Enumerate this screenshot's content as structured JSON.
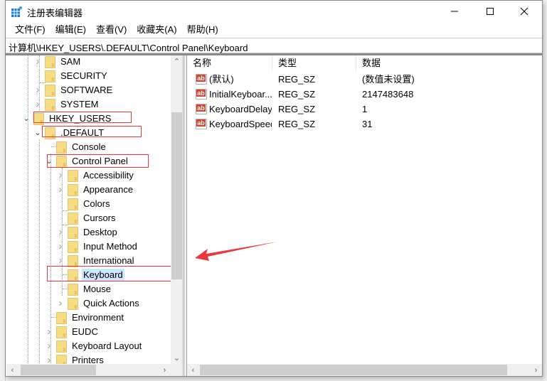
{
  "window": {
    "title": "注册表编辑器",
    "controls": {
      "minimize": "minimize",
      "maximize": "maximize",
      "close": "close"
    }
  },
  "menu": [
    {
      "label": "文件(F)"
    },
    {
      "label": "编辑(E)"
    },
    {
      "label": "查看(V)"
    },
    {
      "label": "收藏夹(A)"
    },
    {
      "label": "帮助(H)"
    }
  ],
  "address": {
    "path": "计算机\\HKEY_USERS\\.DEFAULT\\Control Panel\\Keyboard"
  },
  "tree": {
    "items": [
      {
        "label": "SAM",
        "expander": "collapsed",
        "level": 2
      },
      {
        "label": "SECURITY",
        "expander": "none",
        "level": 2
      },
      {
        "label": "SOFTWARE",
        "expander": "collapsed",
        "level": 2
      },
      {
        "label": "SYSTEM",
        "expander": "collapsed",
        "level": 2
      },
      {
        "label": "HKEY_USERS",
        "expander": "expanded",
        "level": 1,
        "highlighted": true
      },
      {
        "label": ".DEFAULT",
        "expander": "expanded",
        "level": 2,
        "highlighted": true
      },
      {
        "label": "Console",
        "expander": "none",
        "level": 3
      },
      {
        "label": "Control Panel",
        "expander": "expanded",
        "level": 3,
        "highlighted": true
      },
      {
        "label": "Accessibility",
        "expander": "collapsed",
        "level": 4
      },
      {
        "label": "Appearance",
        "expander": "collapsed",
        "level": 4
      },
      {
        "label": "Colors",
        "expander": "none",
        "level": 4
      },
      {
        "label": "Cursors",
        "expander": "none",
        "level": 4
      },
      {
        "label": "Desktop",
        "expander": "collapsed",
        "level": 4
      },
      {
        "label": "Input Method",
        "expander": "collapsed",
        "level": 4
      },
      {
        "label": "International",
        "expander": "collapsed",
        "level": 4
      },
      {
        "label": "Keyboard",
        "expander": "none",
        "level": 4,
        "selected": true,
        "highlighted": true
      },
      {
        "label": "Mouse",
        "expander": "none",
        "level": 4
      },
      {
        "label": "Quick Actions",
        "expander": "collapsed",
        "level": 4
      },
      {
        "label": "Environment",
        "expander": "none",
        "level": 3
      },
      {
        "label": "EUDC",
        "expander": "collapsed",
        "level": 3
      },
      {
        "label": "Keyboard Layout",
        "expander": "collapsed",
        "level": 3
      },
      {
        "label": "Printers",
        "expander": "collapsed",
        "level": 3
      }
    ]
  },
  "list": {
    "columns": [
      {
        "label": "名称"
      },
      {
        "label": "类型"
      },
      {
        "label": "数据"
      }
    ],
    "rows": [
      {
        "name": "(默认)",
        "type": "REG_SZ",
        "data": "(数值未设置)",
        "icon": "string-value-icon"
      },
      {
        "name": "InitialKeyboar...",
        "type": "REG_SZ",
        "data": "2147483648",
        "icon": "string-value-icon"
      },
      {
        "name": "KeyboardDelay",
        "type": "REG_SZ",
        "data": "1",
        "icon": "string-value-icon"
      },
      {
        "name": "KeyboardSpeed",
        "type": "REG_SZ",
        "data": "31",
        "icon": "string-value-icon"
      }
    ]
  },
  "annotation": {
    "arrow_color": "#e8383d",
    "box_color": "#e8383d"
  }
}
